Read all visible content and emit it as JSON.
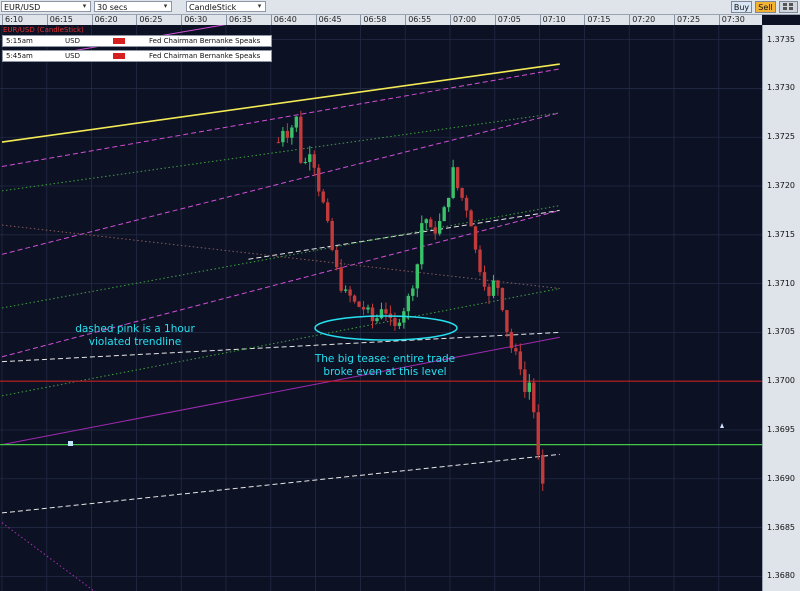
{
  "toolbar": {
    "symbol": "EUR/USD",
    "interval": "30 secs",
    "chart_type": "CandleStick",
    "buy_label": "Buy",
    "sell_label": "Sell"
  },
  "legend": {
    "title": "EUR/USD (CandleStick)"
  },
  "events": [
    {
      "time": "5:15am",
      "currency": "USD",
      "text": "Fed Chairman Bernanke Speaks"
    },
    {
      "time": "5:45am",
      "currency": "USD",
      "text": "Fed Chairman Bernanke Speaks"
    }
  ],
  "annotations": {
    "pink_note": "dashed pink is a 1hour violated trendline",
    "tease_note": "The big tease: entire trade broke even at this level"
  },
  "chart_data": {
    "type": "candlestick",
    "title": "EUR/USD (CandleStick)",
    "interval": "30 secs",
    "time_ticks": [
      "6:10",
      "06:15",
      "06:20",
      "06:25",
      "06:30",
      "06:35",
      "06:40",
      "06:45",
      "06:58",
      "06:55",
      "07:00",
      "07:05",
      "07:10",
      "07:15",
      "07:20",
      "07:25",
      "07:30"
    ],
    "price_ticks": [
      1.3735,
      1.373,
      1.3725,
      1.372,
      1.3715,
      1.371,
      1.3705,
      1.37,
      1.3695,
      1.369,
      1.3685,
      1.368
    ],
    "ylim": [
      1.36785,
      1.37365
    ],
    "close_path": [
      [
        6.17,
        1.37245
      ],
      [
        6.25,
        1.3726
      ],
      [
        6.35,
        1.37255
      ],
      [
        6.45,
        1.37248
      ],
      [
        6.5,
        1.3728
      ],
      [
        6.6,
        1.37265
      ],
      [
        6.7,
        1.3721
      ],
      [
        6.8,
        1.3723
      ],
      [
        6.9,
        1.3724
      ],
      [
        7.0,
        1.37215
      ],
      [
        7.1,
        1.3719
      ],
      [
        7.2,
        1.37178
      ],
      [
        7.35,
        1.37138
      ],
      [
        7.5,
        1.37108
      ],
      [
        7.6,
        1.37092
      ],
      [
        7.75,
        1.37088
      ],
      [
        7.9,
        1.37078
      ],
      [
        8.05,
        1.37075
      ],
      [
        8.2,
        1.3707
      ],
      [
        8.3,
        1.37058
      ],
      [
        8.4,
        1.37068
      ],
      [
        8.5,
        1.3708
      ],
      [
        8.65,
        1.37062
      ],
      [
        8.75,
        1.37052
      ],
      [
        8.9,
        1.37068
      ],
      [
        9.05,
        1.37082
      ],
      [
        9.25,
        1.37112
      ],
      [
        9.4,
        1.37175
      ],
      [
        9.6,
        1.3715
      ],
      [
        9.75,
        1.3716
      ],
      [
        9.95,
        1.37185
      ],
      [
        10.05,
        1.3722
      ],
      [
        10.15,
        1.372
      ],
      [
        10.35,
        1.3718
      ],
      [
        10.45,
        1.37168
      ],
      [
        10.6,
        1.37125
      ],
      [
        10.75,
        1.37105
      ],
      [
        10.9,
        1.3708
      ],
      [
        11.0,
        1.3711
      ],
      [
        11.15,
        1.37082
      ],
      [
        11.3,
        1.37045
      ],
      [
        11.4,
        1.3703
      ],
      [
        11.5,
        1.37025
      ],
      [
        11.6,
        1.37012
      ],
      [
        11.65,
        1.36985
      ],
      [
        11.75,
        1.37005
      ],
      [
        11.8,
        1.3699
      ],
      [
        11.9,
        1.3696
      ],
      [
        12.0,
        1.36905
      ],
      [
        12.08,
        1.36888
      ],
      [
        12.16,
        1.36878
      ]
    ],
    "horizontal_lines": [
      {
        "name": "red level",
        "price": 1.37,
        "color": "#c41e1e",
        "style": "solid"
      },
      {
        "name": "green level",
        "price": 1.36935,
        "color": "#43c843",
        "style": "solid"
      }
    ],
    "trendlines": [
      {
        "name": "yellow",
        "color": "#f3ea55",
        "style": "solid",
        "p1": [
          0,
          1.37245
        ],
        "p2": [
          12.45,
          1.37325
        ]
      },
      {
        "name": "white lower",
        "color": "#e6e6e6",
        "style": "dashed",
        "p1": [
          0,
          1.36865
        ],
        "p2": [
          12.45,
          1.36925
        ]
      },
      {
        "name": "white middle",
        "color": "#e6e6e6",
        "style": "dashed",
        "p1": [
          0,
          1.3702
        ],
        "p2": [
          12.45,
          1.3705
        ]
      },
      {
        "name": "white upper",
        "color": "#e6e6e6",
        "style": "dashed",
        "p1": [
          5.5,
          1.37125
        ],
        "p2": [
          12.45,
          1.37175
        ]
      },
      {
        "name": "pink main",
        "color": "#d14fd6",
        "style": "dashed",
        "p1": [
          0,
          1.37025
        ],
        "p2": [
          12.45,
          1.37175
        ]
      },
      {
        "name": "pink mid",
        "color": "#d14fd6",
        "style": "dashed",
        "p1": [
          0,
          1.3713
        ],
        "p2": [
          12.45,
          1.37275
        ]
      },
      {
        "name": "pink upper",
        "color": "#d14fd6",
        "style": "dashed",
        "p1": [
          0,
          1.3722
        ],
        "p2": [
          12.45,
          1.3732
        ]
      },
      {
        "name": "pink top",
        "color": "#d14fd6",
        "style": "solid",
        "p1": [
          0.5,
          1.3733
        ],
        "p2": [
          6.2,
          1.37375
        ]
      },
      {
        "name": "green lower",
        "color": "#3fa33f",
        "style": "dotted",
        "p1": [
          0,
          1.36985
        ],
        "p2": [
          12.45,
          1.37095
        ]
      },
      {
        "name": "green mid",
        "color": "#3fa33f",
        "style": "dotted",
        "p1": [
          0,
          1.37075
        ],
        "p2": [
          12.45,
          1.3718
        ]
      },
      {
        "name": "green upper",
        "color": "#3fa33f",
        "style": "dotted",
        "p1": [
          0,
          1.37195
        ],
        "p2": [
          12.45,
          1.37275
        ]
      },
      {
        "name": "purple",
        "color": "#a02ab0",
        "style": "solid",
        "p1": [
          0,
          1.36935
        ],
        "p2": [
          12.45,
          1.37045
        ]
      },
      {
        "name": "brown",
        "color": "#8a5a5a",
        "style": "dotted",
        "p1": [
          0,
          1.3716
        ],
        "p2": [
          12.45,
          1.37095
        ]
      },
      {
        "name": "magenta low",
        "color": "#b02ab8",
        "style": "dotted",
        "p1": [
          0,
          1.36855
        ],
        "p2": [
          2.2,
          1.3678
        ]
      }
    ],
    "grid": true,
    "up_color": "#39c26a",
    "down_color": "#c23a3a",
    "background_color": "#0c1124"
  }
}
